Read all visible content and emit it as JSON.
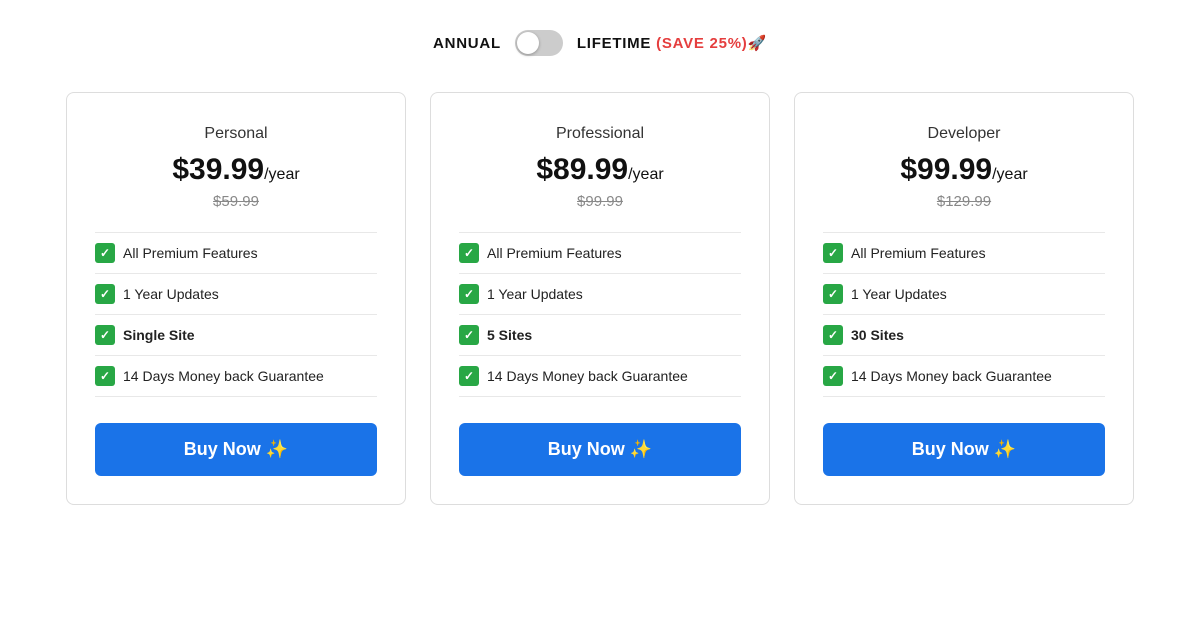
{
  "billing": {
    "annual_label": "ANNUAL",
    "lifetime_label": "LIFETIME",
    "save_badge": "(SAVE 25%)🚀",
    "toggle_state": false
  },
  "plans": [
    {
      "id": "personal",
      "name": "Personal",
      "price": "$39.99",
      "period": "/year",
      "original_price": "$59.99",
      "features": [
        {
          "text": "All Premium Features"
        },
        {
          "text": "1 Year Updates"
        },
        {
          "text": "Single Site",
          "bold": true
        },
        {
          "text": "14 Days Money back Guarantee"
        }
      ],
      "cta": "Buy Now ✨"
    },
    {
      "id": "professional",
      "name": "Professional",
      "price": "$89.99",
      "period": "/year",
      "original_price": "$99.99",
      "features": [
        {
          "text": "All Premium Features"
        },
        {
          "text": "1 Year Updates"
        },
        {
          "text": "5 Sites",
          "bold": true
        },
        {
          "text": "14 Days Money back Guarantee"
        }
      ],
      "cta": "Buy Now ✨"
    },
    {
      "id": "developer",
      "name": "Developer",
      "price": "$99.99",
      "period": "/year",
      "original_price": "$129.99",
      "features": [
        {
          "text": "All Premium Features"
        },
        {
          "text": "1 Year Updates"
        },
        {
          "text": "30 Sites",
          "bold": true
        },
        {
          "text": "14 Days Money back Guarantee"
        }
      ],
      "cta": "Buy Now ✨"
    }
  ]
}
